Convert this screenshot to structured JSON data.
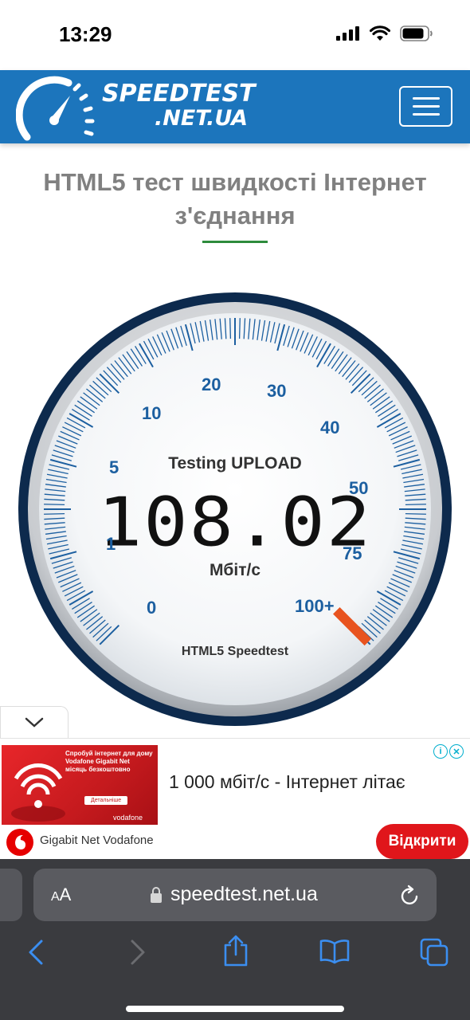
{
  "status_bar": {
    "time": "13:29"
  },
  "header": {
    "logo_line1": "SPEEDTEST",
    "logo_line2": ".NET.UA",
    "brand_color": "#1c75bc"
  },
  "page": {
    "title_line1": "HTML5 тест швидкості Інтернет",
    "title_line2": "з'єднання",
    "accent_underline_color": "#2e8b3c"
  },
  "gauge": {
    "status": "Testing UPLOAD",
    "value": "108.02",
    "unit": "Мбіт/с",
    "brand": "HTML5 Speedtest",
    "needle_level_fraction": 1.0,
    "scale_labels": [
      "0",
      "1",
      "5",
      "10",
      "20",
      "30",
      "40",
      "50",
      "75",
      "100+"
    ],
    "needle_color": "#e8531f",
    "ring_color": "#0d2a4d",
    "tick_color": "#1c5fa0"
  },
  "ad": {
    "image_text": "Спробуй інтернет для дому Vodafone Gigabit Net місяць безкоштовно",
    "image_button": "Детальніше",
    "image_brand": "vodafone",
    "headline": "1 000 мбіт/с - Інтернет літає",
    "advertiser": "Gigabit Net Vodafone",
    "cta": "Відкрити"
  },
  "browser": {
    "aa_label_small": "A",
    "aa_label_large": "A",
    "url": "speedtest.net.ua"
  }
}
